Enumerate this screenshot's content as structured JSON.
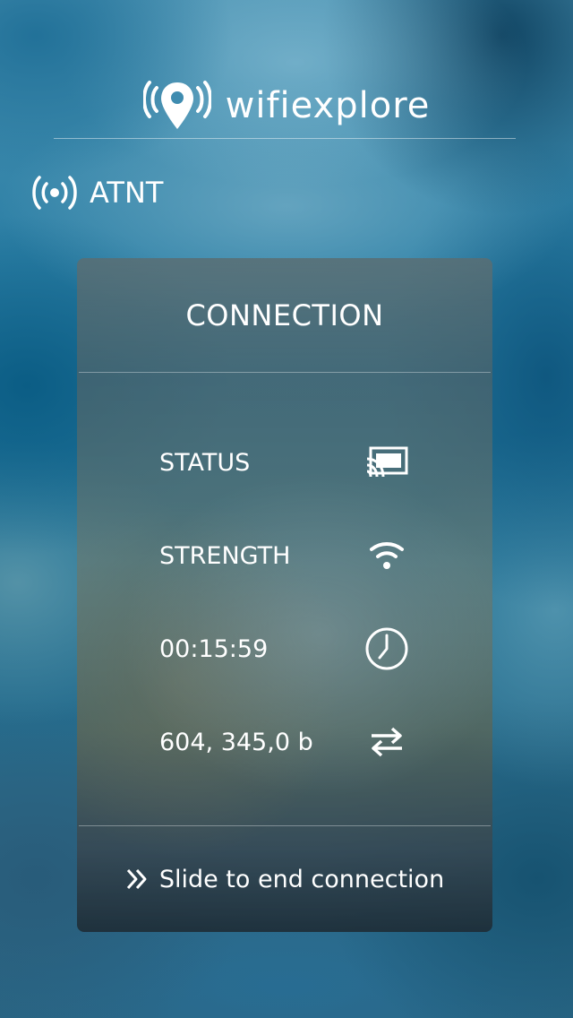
{
  "app": {
    "name": "wifiexplore",
    "logo_icon": "wifi-location-pin-icon"
  },
  "network": {
    "name": "ATNT",
    "icon": "signal-broadcast-icon"
  },
  "card": {
    "title": "CONNECTION",
    "rows": [
      {
        "label": "STATUS",
        "icon": "cast-icon"
      },
      {
        "label": "STRENGTH",
        "icon": "wifi-signal-icon"
      },
      {
        "label": "00:15:59",
        "icon": "clock-icon"
      },
      {
        "label": "604, 345,0 b",
        "icon": "transfer-arrows-icon"
      }
    ],
    "slide_action": {
      "label": "Slide to end connection",
      "icon": "double-chevron-right-icon"
    }
  },
  "colors": {
    "text": "#ffffff",
    "background_blue": "#1f6d8f"
  }
}
